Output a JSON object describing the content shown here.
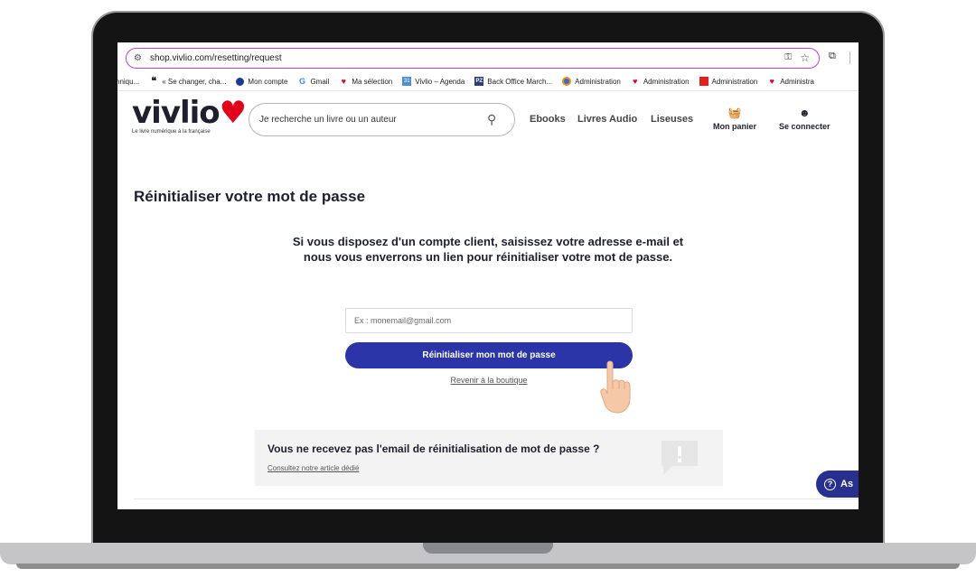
{
  "browser": {
    "url": "shop.vivlio.com/resetting/request",
    "bookmarks": [
      {
        "label": "hniqu...",
        "icon": ""
      },
      {
        "label": "« Se changer, cha...",
        "icon": "quote-icon"
      },
      {
        "label": "Mon compte",
        "icon": "circle-icon"
      },
      {
        "label": "Gmail",
        "icon": "google-icon"
      },
      {
        "label": "Ma sélection",
        "icon": "vivlio-heart-icon"
      },
      {
        "label": "Vivlio – Agenda",
        "icon": "calendar-icon"
      },
      {
        "label": "Back Office March...",
        "icon": "pz-icon"
      },
      {
        "label": "Administration",
        "icon": "admin-icon"
      },
      {
        "label": "Administration",
        "icon": "vivlio-heart-icon"
      },
      {
        "label": "Administration",
        "icon": "red-box-icon"
      },
      {
        "label": "Administra",
        "icon": "vivlio-heart-icon"
      }
    ]
  },
  "header": {
    "logo_text": "vivlio",
    "logo_tagline": "Le livre numérique à la française",
    "search_placeholder": "Je recherche un livre ou un auteur",
    "nav": [
      "Ebooks",
      "Livres Audio",
      "Liseuses"
    ],
    "cart_label": "Mon panier",
    "login_label": "Se connecter"
  },
  "main": {
    "title": "Réinitialiser votre mot de passe",
    "info": "Si vous disposez d'un compte client, saisissez votre adresse e-mail et nous vous enverrons un lien pour réinitialiser votre mot de passe.",
    "email_placeholder": "Ex : monemail@gmail.com",
    "reset_button": "Réinitialiser mon mot de passe",
    "back_link": "Revenir à la boutique"
  },
  "help": {
    "title": "Vous ne recevez pas l'email de réinitialisation de mot de passe ?",
    "link": "Consultez notre article dédié"
  },
  "assist": {
    "label": "As"
  },
  "colors": {
    "brand_red": "#e3001b",
    "button_blue": "#2b35a8",
    "url_border": "#c93fbf"
  }
}
